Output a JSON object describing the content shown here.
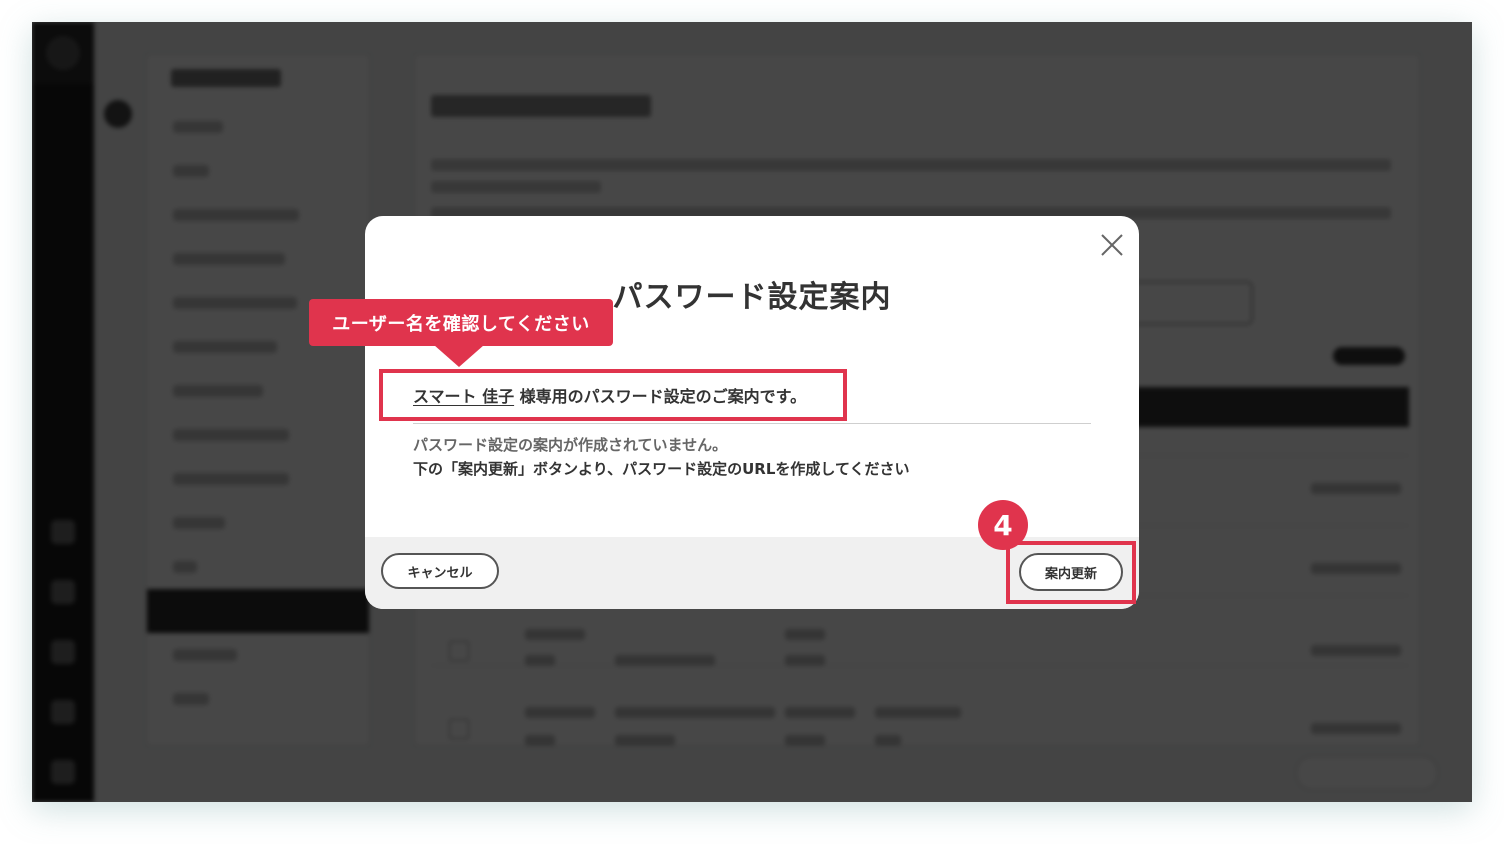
{
  "modal": {
    "title": "パスワード設定案内",
    "user_name": "スマート 佳子",
    "info_suffix": " 様専用のパスワード設定のご案内です。",
    "message_line1": "パスワード設定の案内が作成されていません。",
    "message_line2": "下の「案内更新」ボタンより、パスワード設定のURLを作成してください",
    "cancel_label": "キャンセル",
    "update_label": "案内更新"
  },
  "annotations": {
    "callout_text": "ユーザー名を確認してください",
    "step_number": "4"
  },
  "icons": {
    "close": "close-icon"
  },
  "colors": {
    "accent": "#e0344d",
    "overlay": "rgba(0,0,0,0.72)"
  }
}
